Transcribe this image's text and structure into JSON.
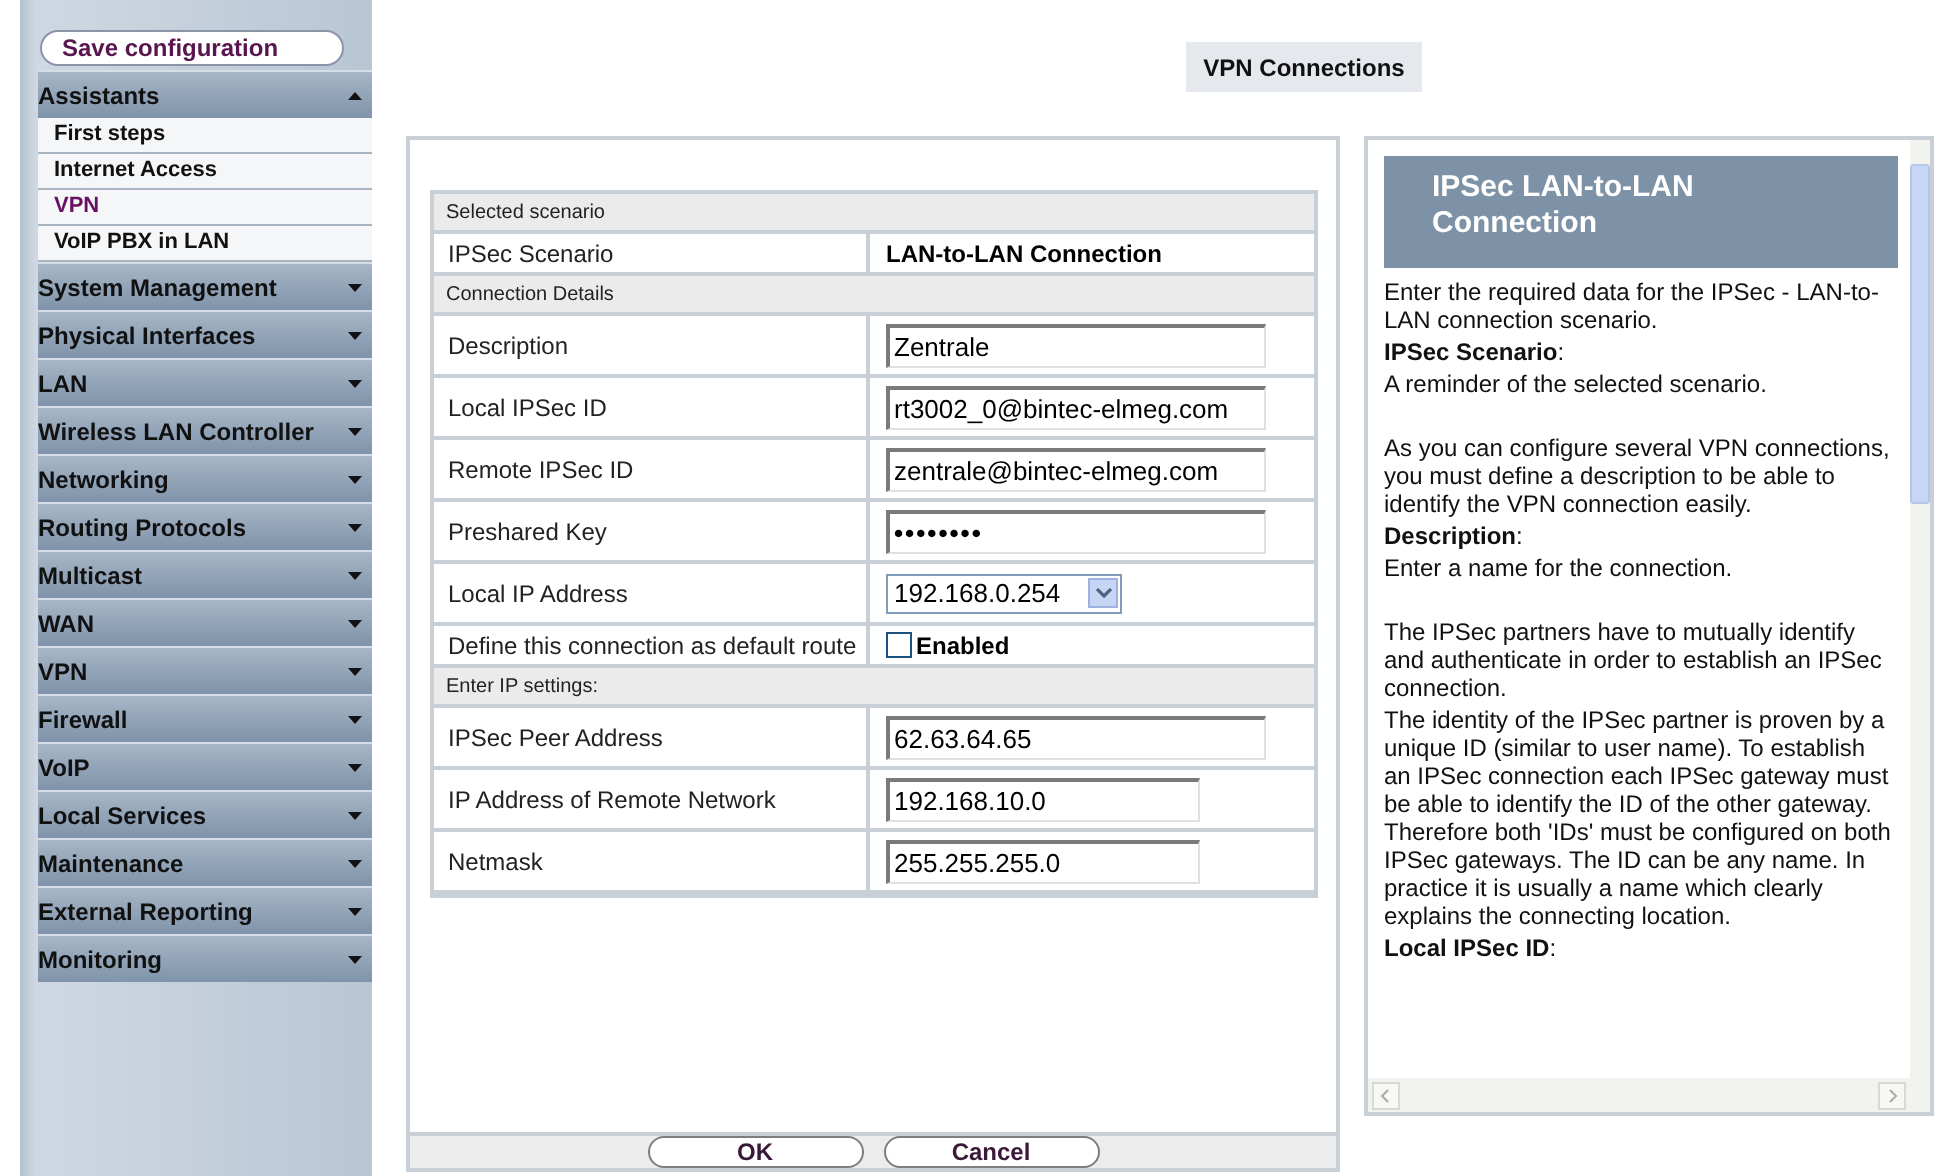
{
  "sidebar": {
    "save_button": "Save configuration",
    "items": [
      {
        "label": "Assistants",
        "expanded": true,
        "children": [
          {
            "label": "First steps",
            "selected": false
          },
          {
            "label": "Internet Access",
            "selected": false
          },
          {
            "label": "VPN",
            "selected": true
          },
          {
            "label": "VoIP PBX in LAN",
            "selected": false
          }
        ]
      },
      {
        "label": "System Management",
        "expanded": false
      },
      {
        "label": "Physical Interfaces",
        "expanded": false
      },
      {
        "label": "LAN",
        "expanded": false
      },
      {
        "label": "Wireless LAN Controller",
        "expanded": false
      },
      {
        "label": "Networking",
        "expanded": false
      },
      {
        "label": "Routing Protocols",
        "expanded": false
      },
      {
        "label": "Multicast",
        "expanded": false
      },
      {
        "label": "WAN",
        "expanded": false
      },
      {
        "label": "VPN",
        "expanded": false
      },
      {
        "label": "Firewall",
        "expanded": false
      },
      {
        "label": "VoIP",
        "expanded": false
      },
      {
        "label": "Local Services",
        "expanded": false
      },
      {
        "label": "Maintenance",
        "expanded": false
      },
      {
        "label": "External Reporting",
        "expanded": false
      },
      {
        "label": "Monitoring",
        "expanded": false
      }
    ]
  },
  "page_title": "VPN Connections",
  "form": {
    "rows": [
      {
        "kind": "section",
        "label": "Selected scenario"
      },
      {
        "kind": "text",
        "label": "IPSec Scenario",
        "value": "LAN-to-LAN Connection"
      },
      {
        "kind": "section",
        "label": "Connection Details"
      },
      {
        "kind": "input",
        "label": "Description",
        "value": "Zentrale"
      },
      {
        "kind": "input",
        "label": "Local IPSec ID",
        "value": "rt3002_0@bintec-elmeg.com"
      },
      {
        "kind": "input",
        "label": "Remote IPSec ID",
        "value": "zentrale@bintec-elmeg.com"
      },
      {
        "kind": "password",
        "label": "Preshared Key",
        "value": "••••••••"
      },
      {
        "kind": "select",
        "label": "Local IP Address",
        "value": "192.168.0.254"
      },
      {
        "kind": "checkbox",
        "label": "Define this connection as default route",
        "value": "Enabled",
        "checked": false
      },
      {
        "kind": "section",
        "label": "Enter IP settings:"
      },
      {
        "kind": "input",
        "label": "IPSec Peer Address",
        "value": "62.63.64.65"
      },
      {
        "kind": "short_input",
        "label": "IP Address of Remote Network",
        "value": "192.168.10.0"
      },
      {
        "kind": "short_input",
        "label": "Netmask",
        "value": "255.255.255.0"
      }
    ],
    "buttons": [
      "OK",
      "Cancel"
    ]
  },
  "help": {
    "title": "IPSec LAN-to-LAN Connection",
    "paragraphs": [
      {
        "kind": "text",
        "text": "Enter the required data for the IPSec - LAN-to-LAN connection scenario."
      },
      {
        "kind": "term",
        "text": "**IPSec Scenario**:"
      },
      {
        "kind": "text",
        "text": "A reminder of the selected scenario."
      },
      {
        "kind": "gap_text",
        "text": "As you can configure several VPN connections, you must define a description to be able to identify the VPN connection easily."
      },
      {
        "kind": "term",
        "text": "**Description**:"
      },
      {
        "kind": "text",
        "text": "Enter a name for the connection."
      },
      {
        "kind": "gap_text",
        "text": "The IPSec partners have to mutually identify and authenticate in order to establish an IPSec connection."
      },
      {
        "kind": "text",
        "text": "The identity of the IPSec partner is proven by a unique ID (similar to user name). To establish an IPSec connection each IPSec gateway must be able to identify the ID of the other gateway. Therefore both 'IDs' must be configured on both IPSec gateways. The ID can be any name. In practice it is usually a name which clearly explains the connecting location."
      },
      {
        "kind": "term",
        "text": "**Local IPSec ID**:"
      }
    ]
  }
}
